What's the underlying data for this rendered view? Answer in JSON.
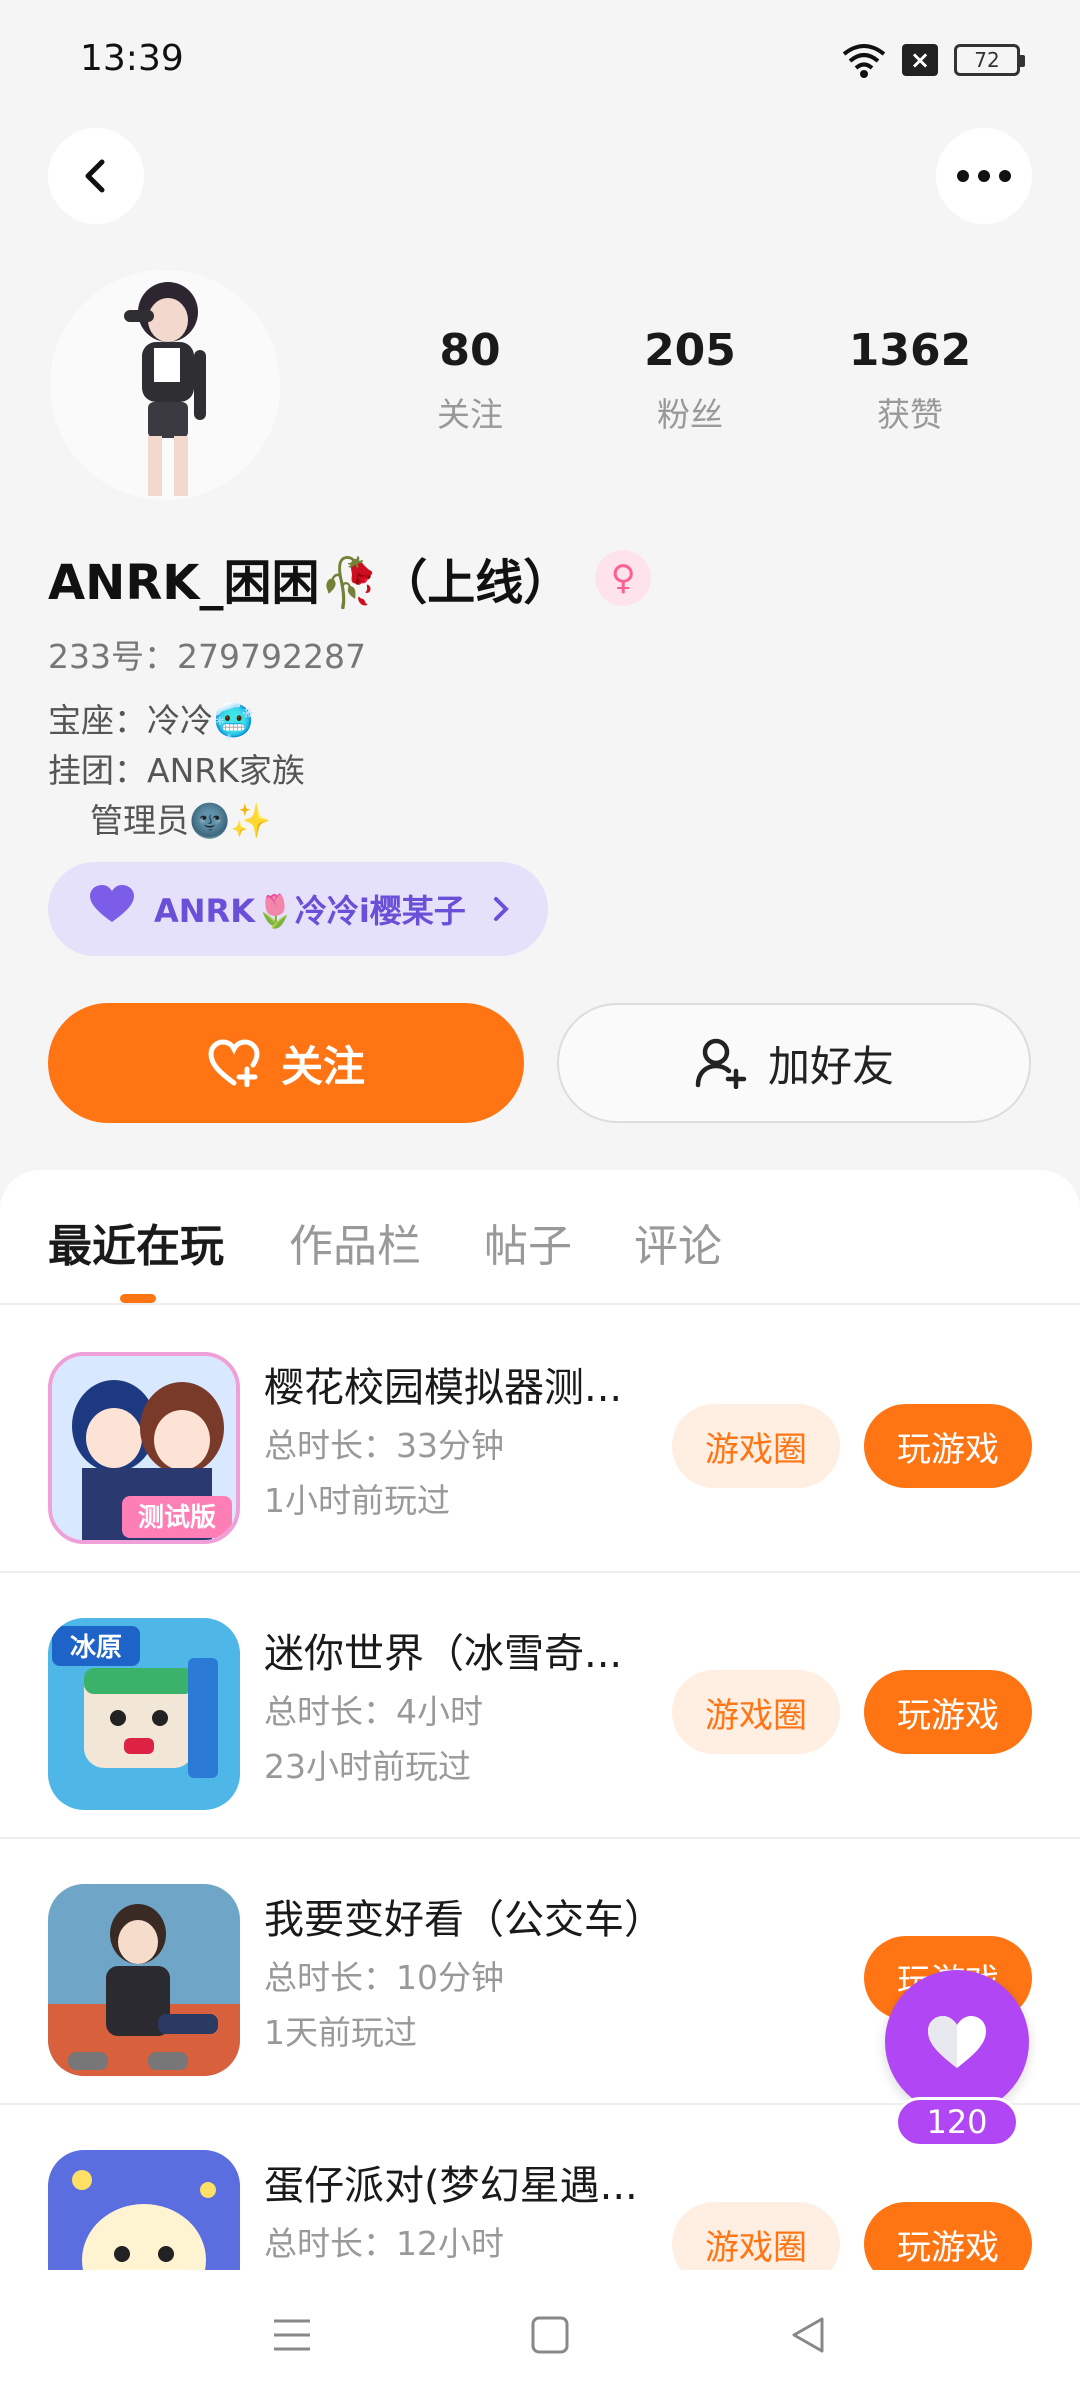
{
  "status_bar": {
    "time": "13:39",
    "battery": "72"
  },
  "profile": {
    "stats": [
      {
        "value": "80",
        "label": "关注"
      },
      {
        "value": "205",
        "label": "粉丝"
      },
      {
        "value": "1362",
        "label": "获赞"
      }
    ],
    "username": "ANRK_困困🥀（上线）",
    "gender": "♀",
    "user_id": "233号：279792287",
    "bio": "宝座：冷冷🥶\n挂团：ANRK家族\n    管理员🌚✨",
    "family_label": "ANRK🌷冷冷i樱某子"
  },
  "actions": {
    "follow": "关注",
    "add_friend": "加好友"
  },
  "tabs": [
    {
      "label": "最近在玩",
      "active": true
    },
    {
      "label": "作品栏",
      "active": false
    },
    {
      "label": "帖子",
      "active": false
    },
    {
      "label": "评论",
      "active": false
    }
  ],
  "games": [
    {
      "title": "樱花校园模拟器测...",
      "duration": "总时长：33分钟",
      "last_played": "1小时前玩过",
      "circle": "游戏圈",
      "play": "玩游戏",
      "show_circle": true,
      "badge": "测试版"
    },
    {
      "title": "迷你世界（冰雪奇...",
      "duration": "总时长：4小时",
      "last_played": "23小时前玩过",
      "circle": "游戏圈",
      "play": "玩游戏",
      "show_circle": true,
      "badge": "冰原"
    },
    {
      "title": "我要变好看（公交车）",
      "duration": "总时长：10分钟",
      "last_played": "1天前玩过",
      "circle": "",
      "play": "玩游戏",
      "show_circle": false,
      "badge": ""
    },
    {
      "title": "蛋仔派对(梦幻星遇...",
      "duration": "总时长：12小时",
      "last_played": "",
      "circle": "游戏圈",
      "play": "玩游戏",
      "show_circle": true,
      "badge": ""
    }
  ],
  "like_count": "120",
  "colors": {
    "accent": "#ff7514",
    "like": "#b046f4",
    "family": "#6a4fd8"
  }
}
